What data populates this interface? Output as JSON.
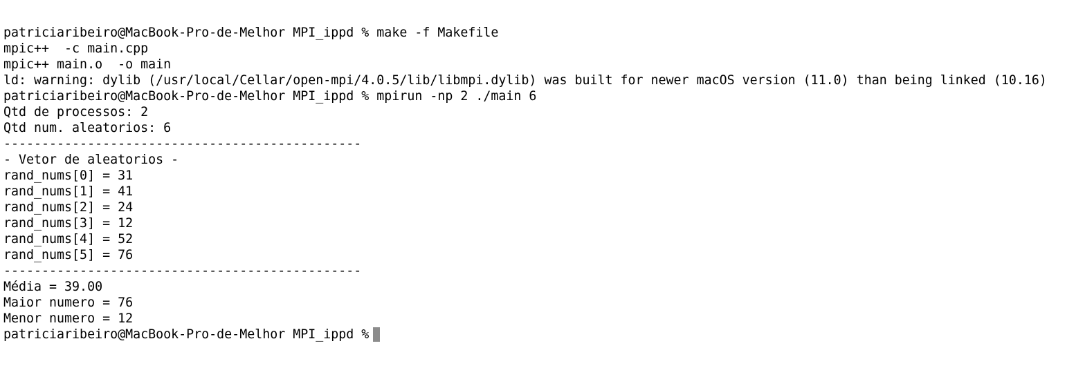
{
  "terminal": {
    "lines": [
      "patriciaribeiro@MacBook-Pro-de-Melhor MPI_ippd % make -f Makefile",
      "mpic++  -c main.cpp",
      "mpic++ main.o  -o main",
      "ld: warning: dylib (/usr/local/Cellar/open-mpi/4.0.5/lib/libmpi.dylib) was built for newer macOS version (11.0) than being linked (10.16)",
      "patriciaribeiro@MacBook-Pro-de-Melhor MPI_ippd % mpirun -np 2 ./main 6",
      "Qtd de processos: 2",
      "Qtd num. aleatorios: 6",
      "-----------------------------------------------",
      "- Vetor de aleatorios -",
      "rand_nums[0] = 31",
      "rand_nums[1] = 41",
      "rand_nums[2] = 24",
      "rand_nums[3] = 12",
      "rand_nums[4] = 52",
      "rand_nums[5] = 76",
      "-----------------------------------------------",
      "Média = 39.00",
      "Maior numero = 76",
      "Menor numero = 12"
    ],
    "prompt": "patriciaribeiro@MacBook-Pro-de-Melhor MPI_ippd %"
  },
  "colors": {
    "background": "#ffffff",
    "text": "#000000",
    "cursor": "#8c8c8c"
  }
}
